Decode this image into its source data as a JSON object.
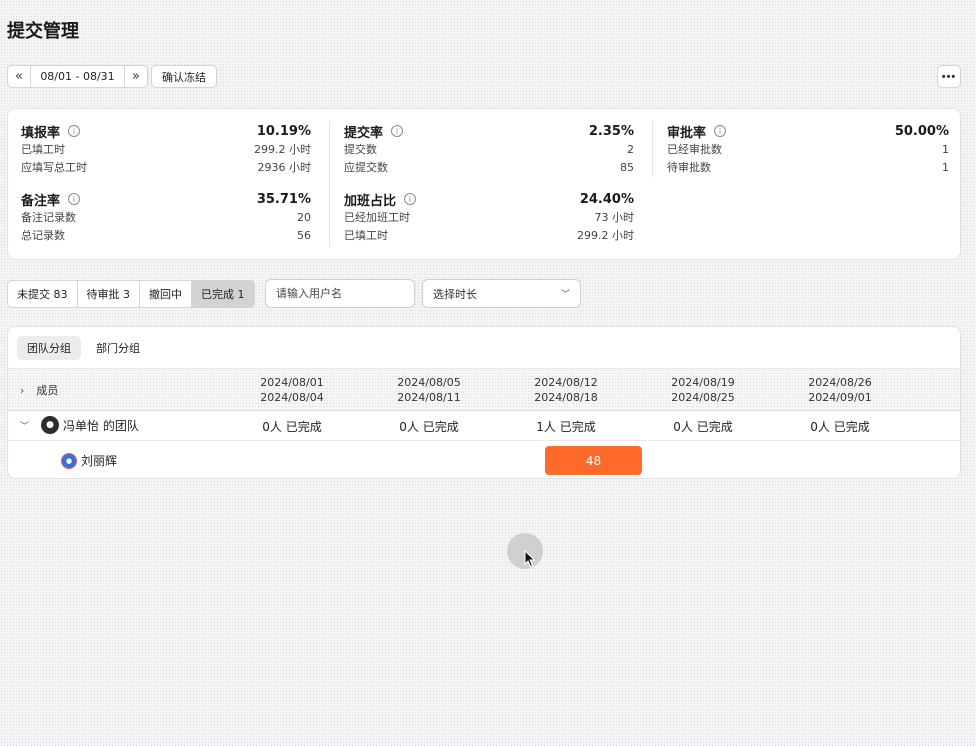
{
  "page": {
    "title": "提交管理"
  },
  "toolbar": {
    "prev_icon": "double-chevron-left-icon",
    "next_icon": "double-chevron-right-icon",
    "date_range": "08/01 - 08/31",
    "confirm_label": "确认冻结",
    "more_icon": "more-icon"
  },
  "stats": {
    "fill_rate": {
      "name": "填报率",
      "percent": "10.19%",
      "rows": [
        {
          "label": "已填工时",
          "value": "299.2 小时"
        },
        {
          "label": "应填写总工时",
          "value": "2936 小时"
        }
      ]
    },
    "submit_rate": {
      "name": "提交率",
      "percent": "2.35%",
      "rows": [
        {
          "label": "提交数",
          "value": "2"
        },
        {
          "label": "应提交数",
          "value": "85"
        }
      ]
    },
    "approve_rate": {
      "name": "审批率",
      "percent": "50.00%",
      "rows": [
        {
          "label": "已经审批数",
          "value": "1"
        },
        {
          "label": "待审批数",
          "value": "1"
        }
      ]
    },
    "note_rate": {
      "name": "备注率",
      "percent": "35.71%",
      "rows": [
        {
          "label": "备注记录数",
          "value": "20"
        },
        {
          "label": "总记录数",
          "value": "56"
        }
      ]
    },
    "overtime_ratio": {
      "name": "加班占比",
      "percent": "24.40%",
      "rows": [
        {
          "label": "已经加班工时",
          "value": "73 小时"
        },
        {
          "label": "已填工时",
          "value": "299.2 小时"
        }
      ]
    }
  },
  "filters": {
    "status_tabs": [
      "未提交 83",
      "待审批 3",
      "撤回中",
      "已完成 1"
    ],
    "active_tab": "已完成 1",
    "user_placeholder": "请输入用户名",
    "duration_placeholder": "选择时长"
  },
  "table": {
    "group_tabs": [
      "团队分组",
      "部门分组"
    ],
    "member_header": "成员",
    "columns": [
      {
        "start": "2024/08/01",
        "end": "2024/08/04"
      },
      {
        "start": "2024/08/05",
        "end": "2024/08/11"
      },
      {
        "start": "2024/08/12",
        "end": "2024/08/18"
      },
      {
        "start": "2024/08/19",
        "end": "2024/08/25"
      },
      {
        "start": "2024/08/26",
        "end": "2024/09/01"
      }
    ],
    "team": {
      "name": "冯单怡 的团队",
      "cells": [
        "0人 已完成",
        "0人 已完成",
        "1人 已完成",
        "0人 已完成",
        "0人 已完成"
      ]
    },
    "member": {
      "name": "刘丽辉",
      "hours": "48"
    }
  }
}
